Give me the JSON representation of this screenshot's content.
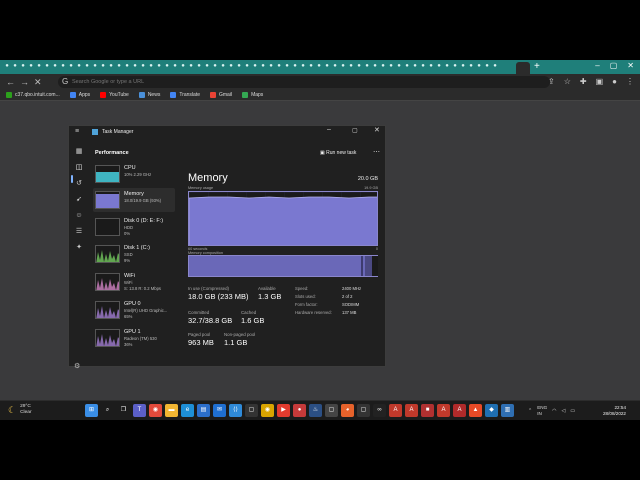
{
  "browser": {
    "omnibox_placeholder": "Search Google or type a URL",
    "bookmarks": [
      {
        "label": "c37.qbo.intuit.com...",
        "color": "#2ca01c"
      },
      {
        "label": "Apps",
        "color": "#4285f4"
      },
      {
        "label": "YouTube",
        "color": "#ff0000"
      },
      {
        "label": "News",
        "color": "#4a90d9"
      },
      {
        "label": "Translate",
        "color": "#4285f4"
      },
      {
        "label": "Gmail",
        "color": "#ea4335"
      },
      {
        "label": "Maps",
        "color": "#34a853"
      }
    ]
  },
  "taskmanager": {
    "title": "Task Manager",
    "section": "Performance",
    "run_new_task": "Run new task",
    "items": [
      {
        "name": "CPU",
        "l2": "10%  2.29 GHz",
        "l3": "",
        "color": "#3fb5c2"
      },
      {
        "name": "Memory",
        "l2": "18.0/19.9 GB (93%)",
        "l3": "",
        "color": "#7a78d0"
      },
      {
        "name": "Disk 0 (D: E: F:)",
        "l2": "HDD",
        "l3": "0%",
        "color": "#6fbf5a"
      },
      {
        "name": "Disk 1 (C:)",
        "l2": "SSD",
        "l3": "9%",
        "color": "#6fbf5a"
      },
      {
        "name": "WiFi",
        "l2": "WiFi",
        "l3": "S: 13.8  R: 0.2 Mbps",
        "color": "#c77dba"
      },
      {
        "name": "GPU 0",
        "l2": "Intel(R) UHD Graphic...",
        "l3": "65%",
        "color": "#9a78c7"
      },
      {
        "name": "GPU 1",
        "l2": "Radeon (TM) 530",
        "l3": "36%",
        "color": "#9a78c7"
      }
    ],
    "detail": {
      "title": "Memory",
      "total": "20.0 GB",
      "usage_label": "Memory usage",
      "usage_max": "19.9 GB",
      "seconds_label": "60 seconds",
      "zero_label": "0",
      "composition_label": "Memory composition",
      "in_use_label": "In use (Compressed)",
      "in_use_value": "18.0 GB (233 MB)",
      "available_label": "Available",
      "available_value": "1.3 GB",
      "committed_label": "Committed",
      "committed_value": "32.7/38.8 GB",
      "cached_label": "Cached",
      "cached_value": "1.6 GB",
      "paged_label": "Paged pool",
      "paged_value": "963 MB",
      "nonpaged_label": "Non-paged pool",
      "nonpaged_value": "1.1 GB",
      "speed_label": "Speed:",
      "speed_value": "2400 MHz",
      "slots_label": "Slots used:",
      "slots_value": "2 of 2",
      "form_label": "Form factor:",
      "form_value": "SODIMM",
      "reserved_label": "Hardware reserved:",
      "reserved_value": "137 MB"
    }
  },
  "taskbar": {
    "temp": "29°C",
    "weather": "Clear",
    "lang1": "ENG",
    "lang2": "IN",
    "time": "22:54",
    "date": "28/08/2022"
  }
}
